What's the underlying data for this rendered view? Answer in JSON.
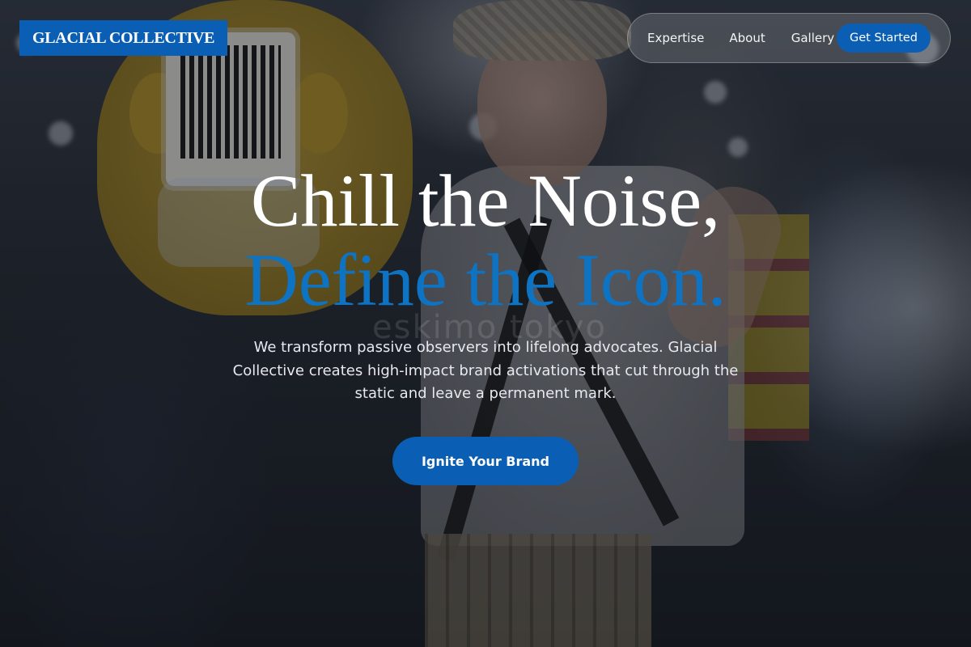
{
  "brand": {
    "logo_text": "GLACIAL COLLECTIVE",
    "accent_color": "#0a5fb4",
    "headline_accent_color": "#0d73c2"
  },
  "nav": {
    "items": [
      {
        "label": "Expertise"
      },
      {
        "label": "About"
      },
      {
        "label": "Gallery"
      }
    ],
    "cta_label": "Get Started"
  },
  "hero": {
    "headline_line1": "Chill the Noise,",
    "headline_line2": "Define the Icon.",
    "subtext": "We transform passive observers into lifelong advocates. Glacial Collective creates high-impact brand activations that cut through the static and leave a permanent mark.",
    "button_label": "Ignite Your Brand",
    "watermark_text": "eskimo tokyo"
  }
}
